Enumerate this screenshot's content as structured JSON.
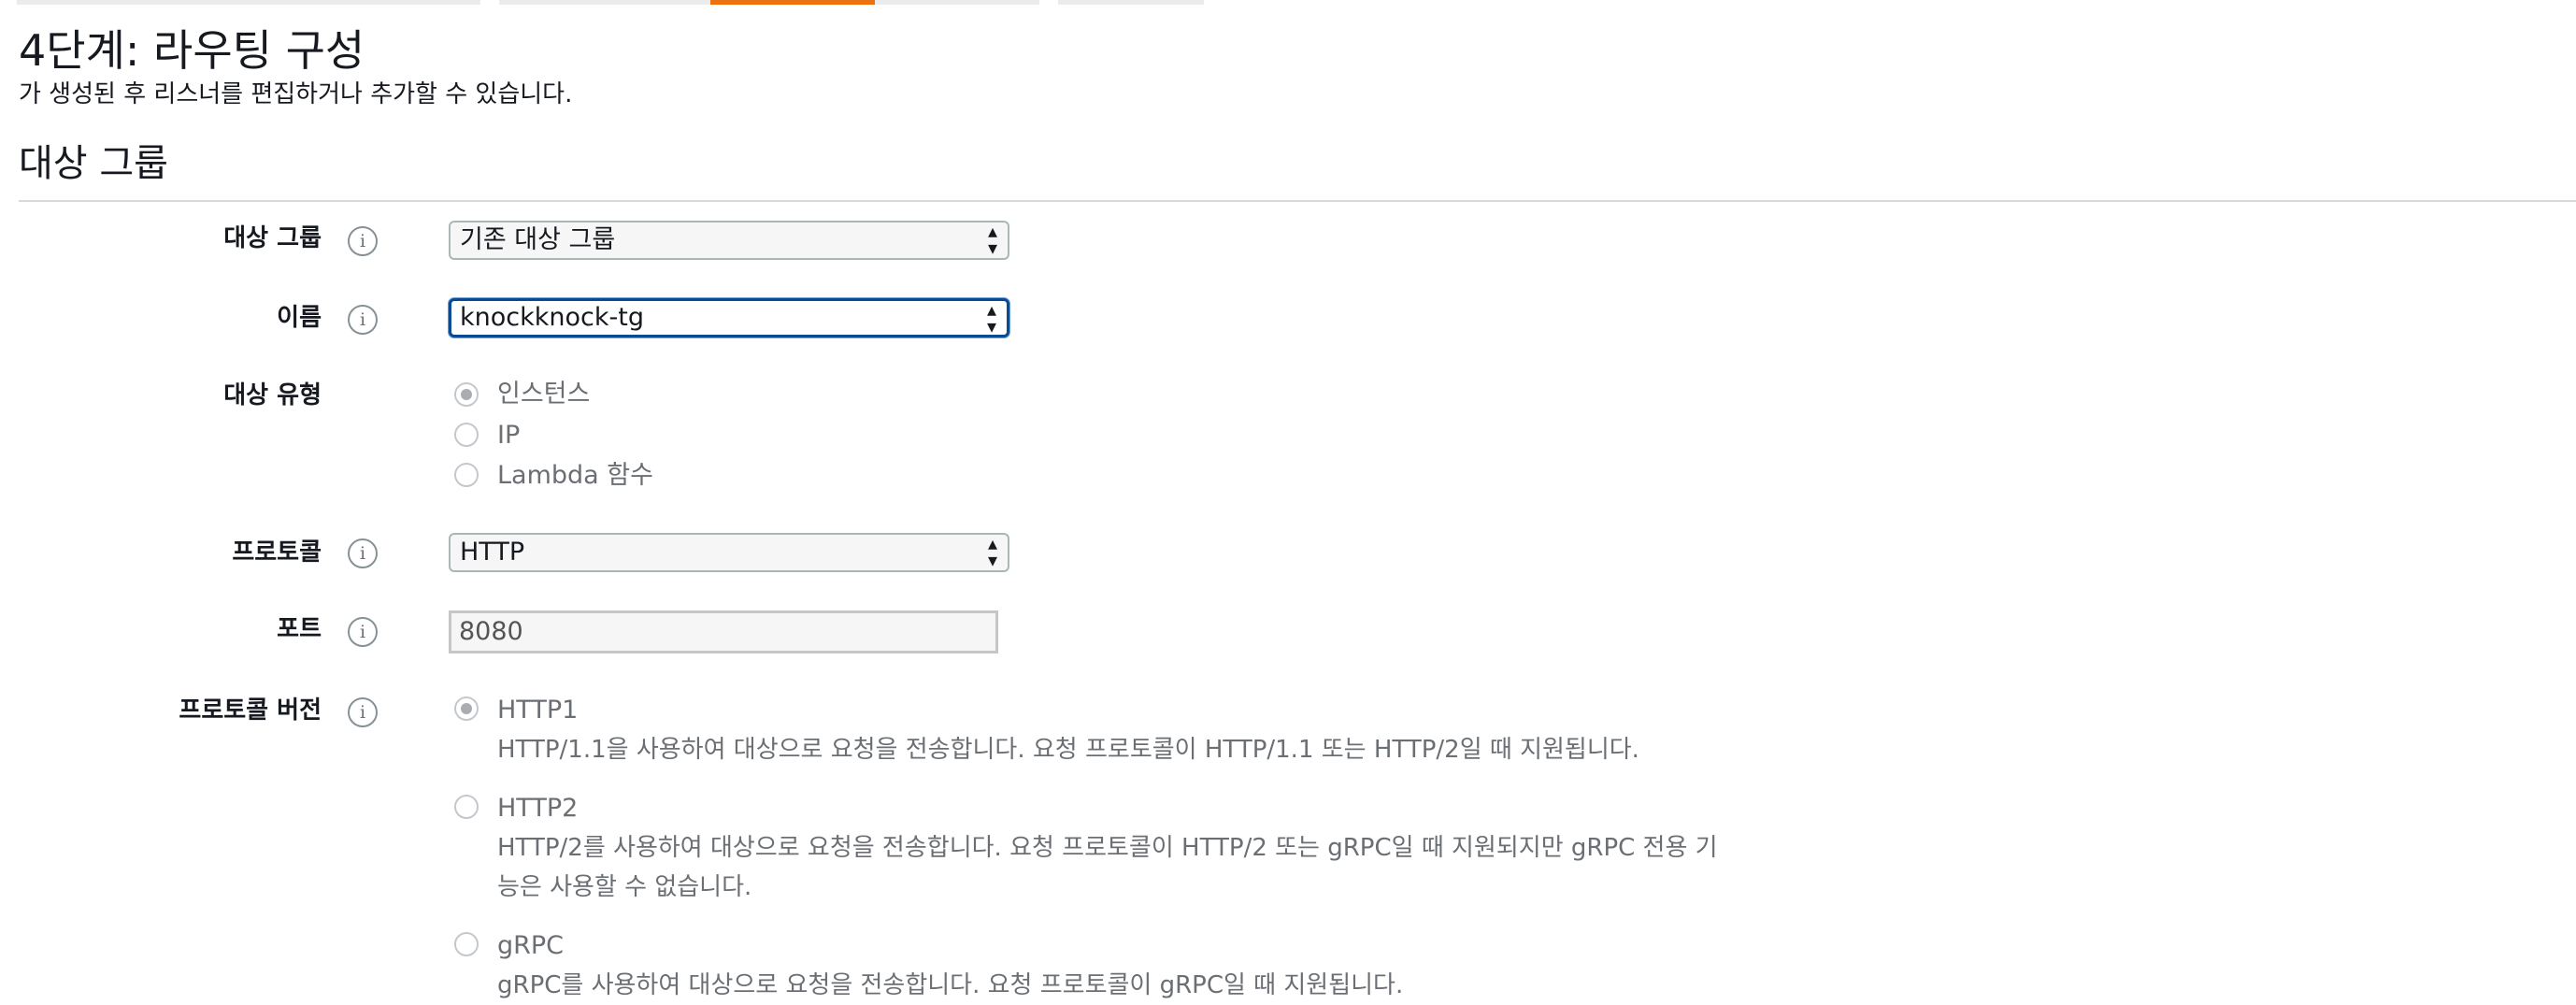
{
  "wizard": {
    "steps": [
      {
        "label": "",
        "active": false
      },
      {
        "label": "",
        "active": false
      },
      {
        "label": "",
        "active": false
      },
      {
        "label": "",
        "active": true
      },
      {
        "label": "",
        "active": false
      },
      {
        "label": "",
        "active": false
      }
    ]
  },
  "page": {
    "title": "4단계: 라우팅 구성",
    "subtitle": "가 생성된 후 리스너를 편집하거나 추가할 수 있습니다."
  },
  "section": {
    "title": "대상 그룹"
  },
  "form": {
    "target_group": {
      "label": "대상 그룹",
      "value": "기존 대상 그룹",
      "info_icon": "info-icon"
    },
    "name": {
      "label": "이름",
      "value": "knockknock-tg",
      "info_icon": "info-icon"
    },
    "target_type": {
      "label": "대상 유형",
      "options": [
        {
          "label": "인스턴스",
          "selected": true
        },
        {
          "label": "IP",
          "selected": false
        },
        {
          "label": "Lambda 함수",
          "selected": false
        }
      ]
    },
    "protocol": {
      "label": "프로토콜",
      "value": "HTTP",
      "info_icon": "info-icon"
    },
    "port": {
      "label": "포트",
      "value": "8080",
      "info_icon": "info-icon"
    },
    "protocol_version": {
      "label": "프로토콜 버전",
      "info_icon": "info-icon",
      "options": [
        {
          "label": "HTTP1",
          "selected": true,
          "description": "HTTP/1.1을 사용하여 대상으로 요청을 전송합니다. 요청 프로토콜이 HTTP/1.1 또는 HTTP/2일 때 지원됩니다."
        },
        {
          "label": "HTTP2",
          "selected": false,
          "description": "HTTP/2를 사용하여 대상으로 요청을 전송합니다. 요청 프로토콜이 HTTP/2 또는 gRPC일 때 지원되지만 gRPC 전용 기능은 사용할 수 없습니다."
        },
        {
          "label": "gRPC",
          "selected": false,
          "description": "gRPC를 사용하여 대상으로 요청을 전송합니다. 요청 프로토콜이 gRPC일 때 지원됩니다."
        }
      ]
    }
  },
  "colors": {
    "active_step": "#ec7211",
    "inactive_step": "#e9ebed",
    "focus_border": "#0a4a94"
  }
}
